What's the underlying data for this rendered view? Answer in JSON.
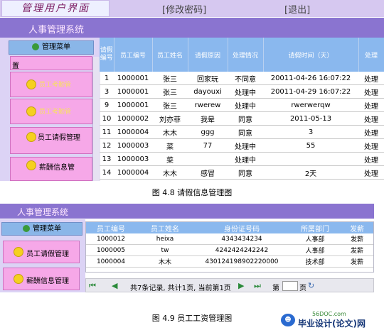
{
  "fig1": {
    "logo": "管理用户界面",
    "links": [
      "[修改密码]",
      "[退出]"
    ],
    "system_title": "人事管理系统",
    "menu_title": "管理菜单",
    "menu_items": [
      "置",
      "员工考勤管",
      "员工考勤管",
      "员工请假管理",
      "薪酬信息管"
    ],
    "headers": [
      "请假编号",
      "员工编号",
      "员工姓名",
      "请假原因",
      "处理情况",
      "请假时间（天）",
      "处理"
    ],
    "rows": [
      [
        "1",
        "1000001",
        "张三",
        "回家玩",
        "不同意",
        "20011-04-26 16:07:22",
        "处理"
      ],
      [
        "3",
        "1000001",
        "张三",
        "dayouxi",
        "处理中",
        "20011-04-29 16:07:22",
        "处理"
      ],
      [
        "9",
        "1000001",
        "张三",
        "rwerew",
        "处理中",
        "rwerwerqw",
        "处理"
      ],
      [
        "10",
        "1000002",
        "刘亦菲",
        "我晕",
        "同意",
        "2011-05-13",
        "处理"
      ],
      [
        "11",
        "1000004",
        "木木",
        "ggg",
        "同意",
        "3",
        "处理"
      ],
      [
        "12",
        "1000003",
        "菜",
        "77",
        "处理中",
        "55",
        "处理"
      ],
      [
        "13",
        "1000003",
        "菜",
        "",
        "处理中",
        "",
        "处理"
      ],
      [
        "14",
        "1000004",
        "木木",
        "感冒",
        "同意",
        "2天",
        "处理"
      ]
    ],
    "caption": "图 4.8  请假信息管理图"
  },
  "fig2": {
    "system_title": "人事管理系统",
    "menu_title": "管理菜单",
    "menu_items": [
      "员工请假管理",
      "薪酬信息管理"
    ],
    "headers": [
      "员工编号",
      "员工姓名",
      "身份证号码",
      "所属部门",
      "发薪"
    ],
    "rows": [
      [
        "1000012",
        "heixa",
        "4343434234",
        "人事部",
        "发薪"
      ],
      [
        "1000005",
        "tw",
        "4242424242242",
        "人事部",
        "发薪"
      ],
      [
        "1000004",
        "木木",
        "430124198902220000",
        "技术部",
        "发薪"
      ]
    ],
    "pager": {
      "summary": "共7条记录, 共计1页, 当前第1页",
      "page_label": "第",
      "page_suffix": "页"
    },
    "caption": "图 4.9 员工工资管理图"
  },
  "brand": {
    "url": "56DOC.com",
    "text": "毕业设计(论文)网"
  }
}
